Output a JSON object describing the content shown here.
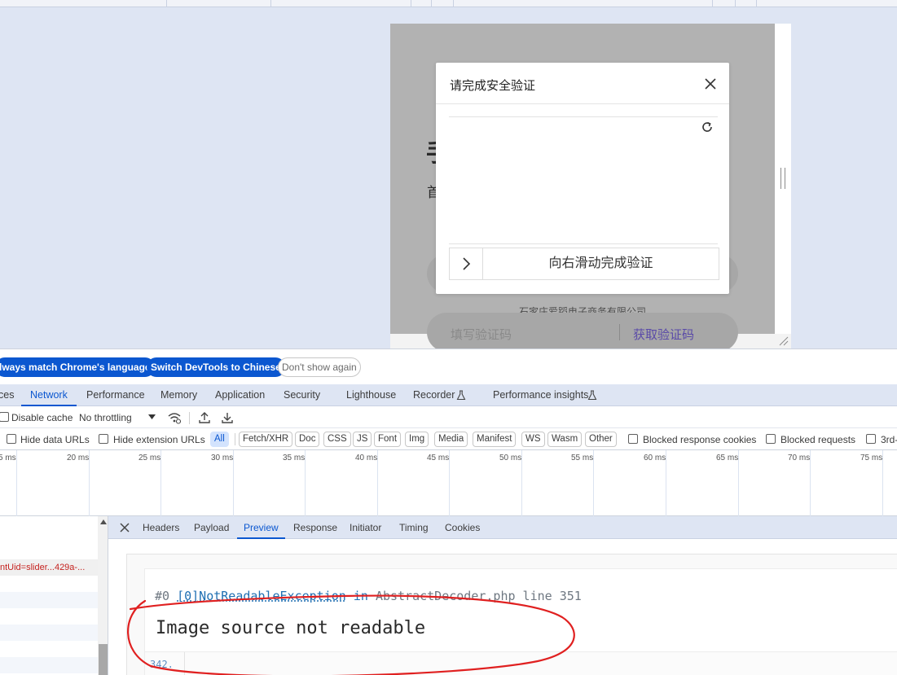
{
  "viewport": {
    "background_page": {
      "glyph_1": "手",
      "glyph_2": "首",
      "company": "石家庄爱蹈电子商务有限公司",
      "code_placeholder": "填写验证码",
      "get_code": "获取验证码"
    },
    "captcha": {
      "title": "请完成安全验证",
      "slider_text": "向右滑动完成验证",
      "close_icon": "close-icon",
      "refresh_icon": "refresh-icon",
      "slider_icon": "chevron-right-icon"
    }
  },
  "devtools": {
    "language_bar": {
      "always_match": "lways match Chrome's language",
      "switch": "Switch DevTools to Chinese",
      "dont_show": "Don't show again"
    },
    "main_tabs": [
      {
        "label": "ces",
        "active": false
      },
      {
        "label": "Network",
        "active": true
      },
      {
        "label": "Performance",
        "active": false
      },
      {
        "label": "Memory",
        "active": false
      },
      {
        "label": "Application",
        "active": false
      },
      {
        "label": "Security",
        "active": false
      },
      {
        "label": "Lighthouse",
        "active": false
      },
      {
        "label": "Recorder",
        "active": false
      },
      {
        "label": "Performance insights",
        "active": false
      }
    ],
    "toolbar1": {
      "disable_cache": "Disable cache",
      "throttling": "No throttling"
    },
    "toolbar2": {
      "hide_data_urls": "Hide data URLs",
      "hide_extension_urls": "Hide extension URLs",
      "filters": [
        "All",
        "Fetch/XHR",
        "Doc",
        "CSS",
        "JS",
        "Font",
        "Img",
        "Media",
        "Manifest",
        "WS",
        "Wasm",
        "Other"
      ],
      "active_filter": "All",
      "blocked_response_cookies": "Blocked response cookies",
      "blocked_requests": "Blocked requests",
      "third_party": "3rd-"
    },
    "timeline_ticks": [
      "5 ms",
      "20 ms",
      "25 ms",
      "30 ms",
      "35 ms",
      "40 ms",
      "45 ms",
      "50 ms",
      "55 ms",
      "60 ms",
      "65 ms",
      "70 ms",
      "75 ms"
    ],
    "request_list": {
      "rows": [
        {
          "name": "",
          "type": "partial"
        },
        {
          "name": "ntUid=slider...429a-...",
          "type": "error"
        },
        {
          "name": "",
          "type": "plain"
        },
        {
          "name": "",
          "type": "alt"
        },
        {
          "name": "",
          "type": "plain"
        },
        {
          "name": "",
          "type": "alt"
        },
        {
          "name": "",
          "type": "plain"
        },
        {
          "name": "",
          "type": "alt"
        },
        {
          "name": "",
          "type": "plain"
        }
      ]
    },
    "detail_tabs": [
      {
        "label": "Headers",
        "active": false
      },
      {
        "label": "Payload",
        "active": false
      },
      {
        "label": "Preview",
        "active": true
      },
      {
        "label": "Response",
        "active": false
      },
      {
        "label": "Initiator",
        "active": false
      },
      {
        "label": "Timing",
        "active": false
      },
      {
        "label": "Cookies",
        "active": false
      }
    ],
    "preview": {
      "frame_prefix": "#0 ",
      "exception_link": "[0]NotReadableException",
      "in_word": " in ",
      "location": "AbstractDecoder.php line 351",
      "message": "Image source not readable",
      "line_number": "342."
    }
  },
  "colors": {
    "accent": "#0b57d0",
    "error_text": "#c5221f",
    "annotation": "#e02020"
  }
}
